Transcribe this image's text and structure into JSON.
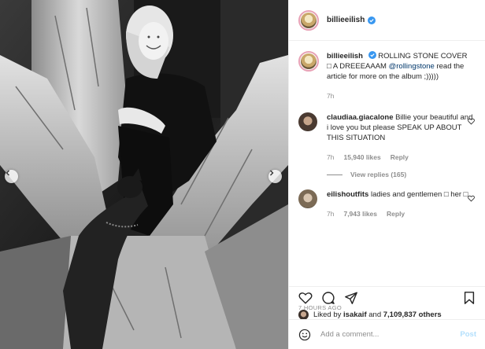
{
  "post": {
    "author": "billieeilish",
    "verified": true,
    "caption": {
      "username": "billieeilish",
      "text_before_mention": "ROLLING STONE COVER □ A DREEEAAAM",
      "mention": "@rollingstone",
      "text_after_mention": "read the article for more on the album ;)))))",
      "time": "7h"
    },
    "comments": [
      {
        "username": "claudiaa.giacalone",
        "text": "Billie your beautiful and i love you but please SPEAK UP ABOUT THIS SITUATION",
        "time": "7h",
        "likes": "15,940 likes",
        "reply_label": "Reply",
        "view_replies": "View replies (165)"
      },
      {
        "username": "eilishoutfits",
        "text": "ladies and gentlemen □ her □",
        "time": "7h",
        "likes": "7,943 likes",
        "reply_label": "Reply"
      }
    ],
    "likes_line": {
      "prefix": "Liked by",
      "user": "isakaif",
      "joiner": "and",
      "others": "7,109,837 others"
    },
    "timestamp": "7 HOURS AGO",
    "add_comment": {
      "placeholder": "Add a comment...",
      "post_label": "Post"
    }
  },
  "icons": {
    "verified": "verified-badge-icon",
    "like": "heart-icon",
    "comment": "comment-bubble-icon",
    "share": "paper-plane-icon",
    "save": "bookmark-icon",
    "emoji": "smiley-icon",
    "prev": "chevron-left-icon",
    "next": "chevron-right-icon"
  },
  "colors": {
    "verified": "#3897f0",
    "link": "#00376b",
    "muted": "#8e8e8e",
    "post_button": "#b2dffc"
  }
}
